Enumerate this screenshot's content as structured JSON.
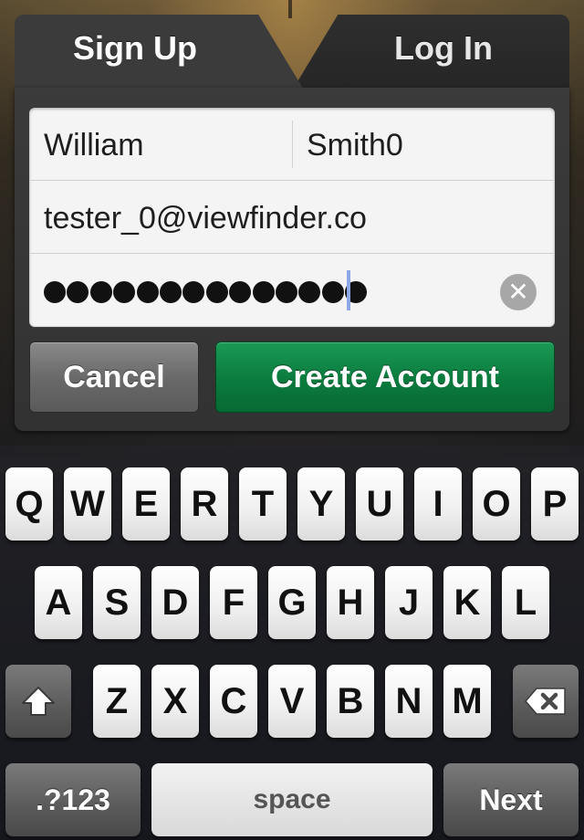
{
  "tabs": {
    "signup_label": "Sign Up",
    "login_label": "Log In"
  },
  "form": {
    "first_name": "William",
    "last_name": "Smith0",
    "email": "tester_0@viewfinder.co",
    "password_dots": 14
  },
  "buttons": {
    "cancel_label": "Cancel",
    "create_label": "Create Account"
  },
  "keyboard": {
    "row1": [
      "Q",
      "W",
      "E",
      "R",
      "T",
      "Y",
      "U",
      "I",
      "O",
      "P"
    ],
    "row2": [
      "A",
      "S",
      "D",
      "F",
      "G",
      "H",
      "J",
      "K",
      "L"
    ],
    "row3": [
      "Z",
      "X",
      "C",
      "V",
      "B",
      "N",
      "M"
    ],
    "numbers_label": ".?123",
    "space_label": "space",
    "next_label": "Next"
  },
  "icons": {
    "clear": "clear-icon",
    "shift": "shift-icon",
    "backspace": "backspace-icon"
  },
  "colors": {
    "create_button": "#0c7d3f",
    "caret": "#8ea8e6"
  }
}
